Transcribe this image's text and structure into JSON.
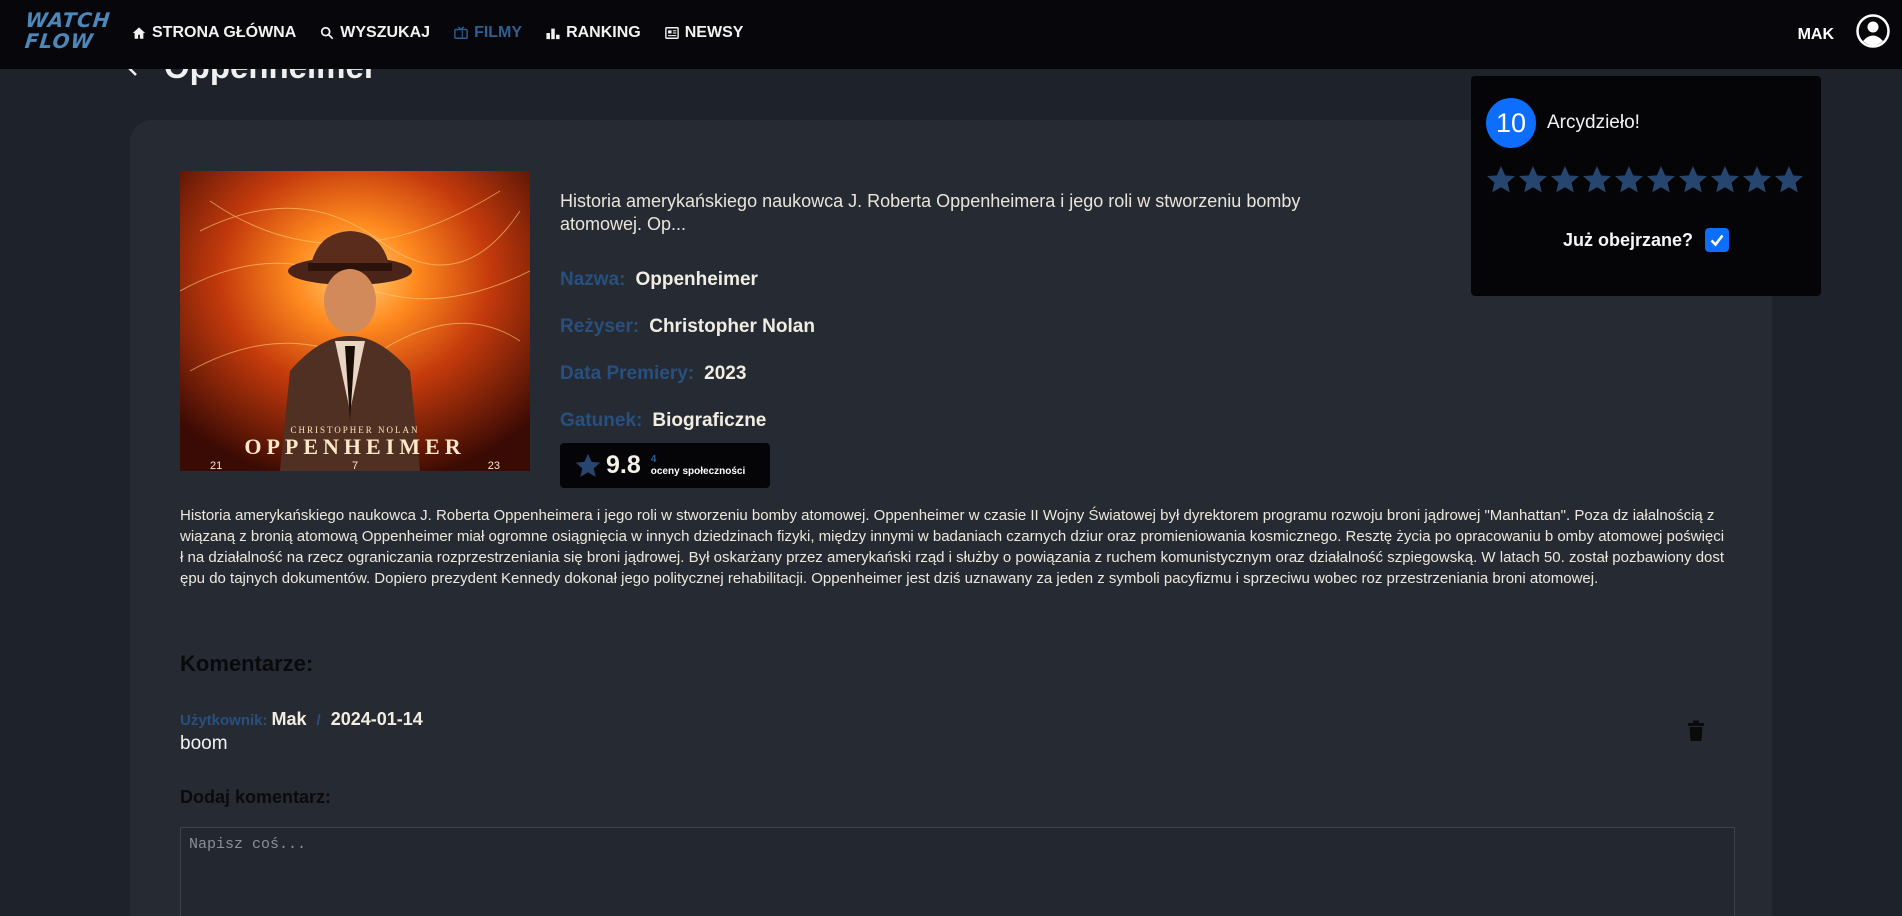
{
  "nav": {
    "logo_line1": "WATCH",
    "logo_line2": "FLOW",
    "items": [
      {
        "label": "STRONA GŁÓWNA",
        "icon": "home-icon"
      },
      {
        "label": "WYSZUKAJ",
        "icon": "search-icon"
      },
      {
        "label": "FILMY",
        "icon": "tv-icon",
        "active": true
      },
      {
        "label": "RANKING",
        "icon": "ranking-icon"
      },
      {
        "label": "NEWSY",
        "icon": "news-icon"
      }
    ],
    "username": "MAK"
  },
  "page": {
    "title": "Oppenheimer"
  },
  "movie": {
    "poster_credit": "CHRISTOPHER NOLAN",
    "poster_title": "OPPENHEIMER",
    "poster_date": [
      "21",
      "7",
      "23"
    ],
    "short_description": "Historia amerykańskiego naukowca J. Roberta Oppenheimera i jego roli w stworzeniu bomby atomowej. Op...",
    "name_label": "Nazwa:",
    "name": "Oppenheimer",
    "director_label": "Reżyser:",
    "director": "Christopher Nolan",
    "release_label": "Data Premiery:",
    "release": "2023",
    "genre_label": "Gatunek:",
    "genre": "Biograficzne",
    "rating": "9.8",
    "rating_count": "4",
    "rating_caption": "oceny społeczności",
    "long_description": "Historia amerykańskiego naukowca J. Roberta Oppenheimera i jego roli w stworzeniu bomby atomowej. Oppenheimer w czasie II Wojny Światowej był dyrektorem programu rozwoju broni jądrowej \"Manhattan\". Poza dz iałalnością związaną z bronią atomową Oppenheimer miał ogromne osiągnięcia w innych dziedzinach fizyki, między innymi w badaniach czarnych dziur oraz promieniowania kosmicznego. Resztę życia po opracowaniu b omby atomowej poświęcił na działalność na rzecz ograniczania rozprzestrzeniania się broni jądrowej. Był oskarżany przez amerykański rząd i służby o powiązania z ruchem komunistycznym oraz działalność szpiegowską. W latach 50. został pozbawiony dostępu do tajnych dokumentów. Dopiero prezydent Kennedy dokonał jego politycznej rehabilitacji. Oppenheimer jest dziś uznawany za jeden z symboli pacyfizmu i sprzeciwu wobec roz przestrzeniania broni atomowej."
  },
  "comments": {
    "title": "Komentarze:",
    "items": [
      {
        "user_label": "Użytkownik:",
        "user": "Mak",
        "separator": "/",
        "date": "2024-01-14",
        "text": "boom"
      }
    ],
    "add_title": "Dodaj komentarz:",
    "placeholder": "Napisz coś..."
  },
  "rating_popup": {
    "score": "10",
    "label": "Arcydzieło!",
    "stars_total": 10,
    "stars_selected": 10,
    "star_color": "#27466f",
    "watched_label": "Już obejrzane?",
    "watched": true
  },
  "colors": {
    "accent": "#0d6efd",
    "label_blue": "#28507e",
    "nav_bg": "#07070b",
    "page_bg": "#1e222b",
    "card_bg": "#262a33"
  }
}
